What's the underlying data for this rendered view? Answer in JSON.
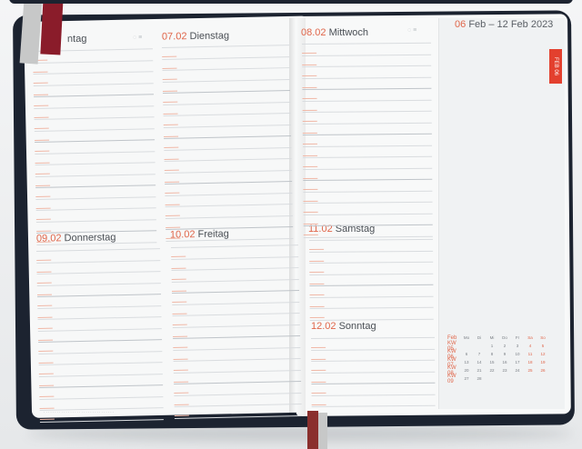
{
  "planner": {
    "days": [
      {
        "num": "",
        "name": "ntag"
      },
      {
        "num": "07.02",
        "name": "Dienstag"
      },
      {
        "num": "08.02",
        "name": "Mittwoch"
      },
      {
        "num": "09.02",
        "name": "Donnerstag"
      },
      {
        "num": "10.02",
        "name": "Freitag"
      },
      {
        "num": "11.02",
        "name": "Samstag"
      },
      {
        "num": "12.02",
        "name": "Sonntag"
      }
    ],
    "week_range": {
      "start_num": "06",
      "start_rest": "Feb",
      "sep": "–",
      "end": "12 Feb 2023"
    },
    "week_tab": "FEB 06",
    "mini_calendar": {
      "month": "Feb",
      "headers": [
        "Mo",
        "Di",
        "Mi",
        "Do",
        "Fr",
        "Sa",
        "So"
      ],
      "weeks": [
        {
          "wk": "KW 05",
          "days": [
            "",
            "",
            "1",
            "2",
            "3",
            "4",
            "5"
          ]
        },
        {
          "wk": "KW 06",
          "days": [
            "6",
            "7",
            "8",
            "9",
            "10",
            "11",
            "12"
          ]
        },
        {
          "wk": "KW 07",
          "days": [
            "13",
            "14",
            "15",
            "16",
            "17",
            "18",
            "19"
          ]
        },
        {
          "wk": "KW 08",
          "days": [
            "20",
            "21",
            "22",
            "23",
            "24",
            "25",
            "26"
          ]
        },
        {
          "wk": "KW 09",
          "days": [
            "27",
            "28",
            "",
            "",
            "",
            "",
            ""
          ]
        }
      ]
    }
  },
  "colors": {
    "cover": "#1c2330",
    "accent": "#e0664a",
    "tab": "#e3402e"
  }
}
